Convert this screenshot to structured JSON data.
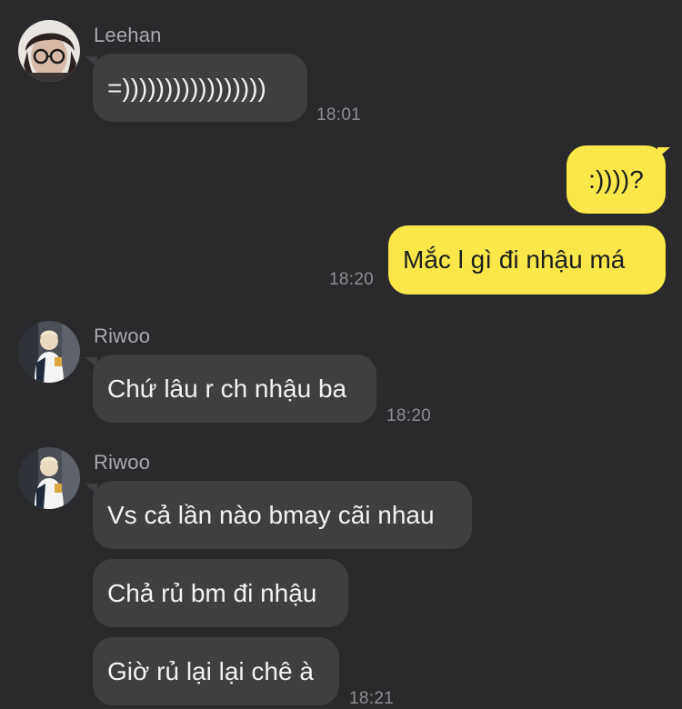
{
  "messages": {
    "m1": {
      "sender": "Leehan",
      "text": "=)))))))))))))))))",
      "time": "18:01",
      "avatar": "avatar-leehan"
    },
    "m2": {
      "text": ":))))?"
    },
    "m3": {
      "text": "Mắc l gì đi nhậu má",
      "time": "18:20"
    },
    "m4": {
      "sender": "Riwoo",
      "text": "Chứ lâu r ch nhậu ba",
      "time": "18:20",
      "avatar": "avatar-riwoo"
    },
    "m5": {
      "sender": "Riwoo",
      "avatar": "avatar-riwoo",
      "lines": [
        "Vs cả lần nào bmay cãi nhau",
        "Chả rủ bm đi nhậu",
        "Giờ rủ lại lại chê à"
      ],
      "time": "18:21"
    }
  },
  "colors": {
    "background": "#2a2a2c",
    "incoming_bubble": "#3f3f42",
    "outgoing_bubble": "#fbe74a"
  }
}
